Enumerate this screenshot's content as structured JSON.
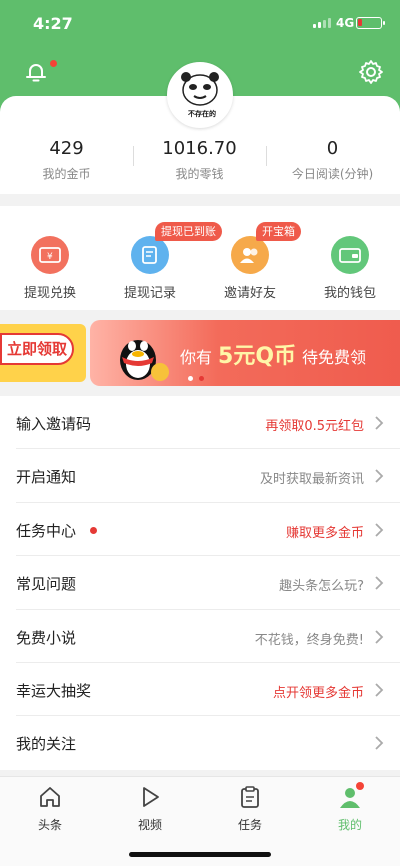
{
  "status_bar": {
    "time": "4:27",
    "network": "4G"
  },
  "colors": {
    "brand": "#5fbe6c",
    "accent_red": "#e53935",
    "low_battery": "#e53935"
  },
  "header": {
    "avatar_caption": "不存在的",
    "icons": [
      "bell-icon",
      "gear-icon"
    ]
  },
  "stats": [
    {
      "value": "429",
      "label": "我的金币"
    },
    {
      "value": "1016.70",
      "label": "我的零钱"
    },
    {
      "value": "0",
      "label": "今日阅读(分钟)"
    }
  ],
  "quick_actions": [
    {
      "label": "提现兑换",
      "icon": "ticket-icon",
      "color": "#f2715e"
    },
    {
      "label": "提现记录",
      "icon": "record-icon",
      "color": "#5fb2ee",
      "tag": "提现已到账"
    },
    {
      "label": "邀请好友",
      "icon": "friends-icon",
      "color": "#f6a94a",
      "tag": "开宝箱"
    },
    {
      "label": "我的钱包",
      "icon": "wallet-icon",
      "color": "#62c77a"
    }
  ],
  "banner": {
    "left_button": "立即领取",
    "prefix": "你有",
    "highlight": "5元Q币",
    "suffix": "待免费领"
  },
  "menu": [
    {
      "label": "输入邀请码",
      "hint": "再领取0.5元红包",
      "hint_color": "red",
      "dot": false
    },
    {
      "label": "开启通知",
      "hint": "及时获取最新资讯",
      "hint_color": "gray",
      "dot": false
    },
    {
      "label": "任务中心",
      "hint": "赚取更多金币",
      "hint_color": "red",
      "dot": true
    },
    {
      "label": "常见问题",
      "hint": "趣头条怎么玩?",
      "hint_color": "gray",
      "dot": false
    },
    {
      "label": "免费小说",
      "hint": "不花钱，终身免费!",
      "hint_color": "gray",
      "dot": false
    },
    {
      "label": "幸运大抽奖",
      "hint": "点开领更多金币",
      "hint_color": "red",
      "dot": false
    },
    {
      "label": "我的关注",
      "hint": "",
      "hint_color": "gray",
      "dot": false
    }
  ],
  "tabbar": [
    {
      "label": "头条",
      "icon": "home-icon",
      "active": false
    },
    {
      "label": "视频",
      "icon": "play-icon",
      "active": false
    },
    {
      "label": "任务",
      "icon": "task-icon",
      "active": false
    },
    {
      "label": "我的",
      "icon": "person-icon",
      "active": true
    }
  ]
}
